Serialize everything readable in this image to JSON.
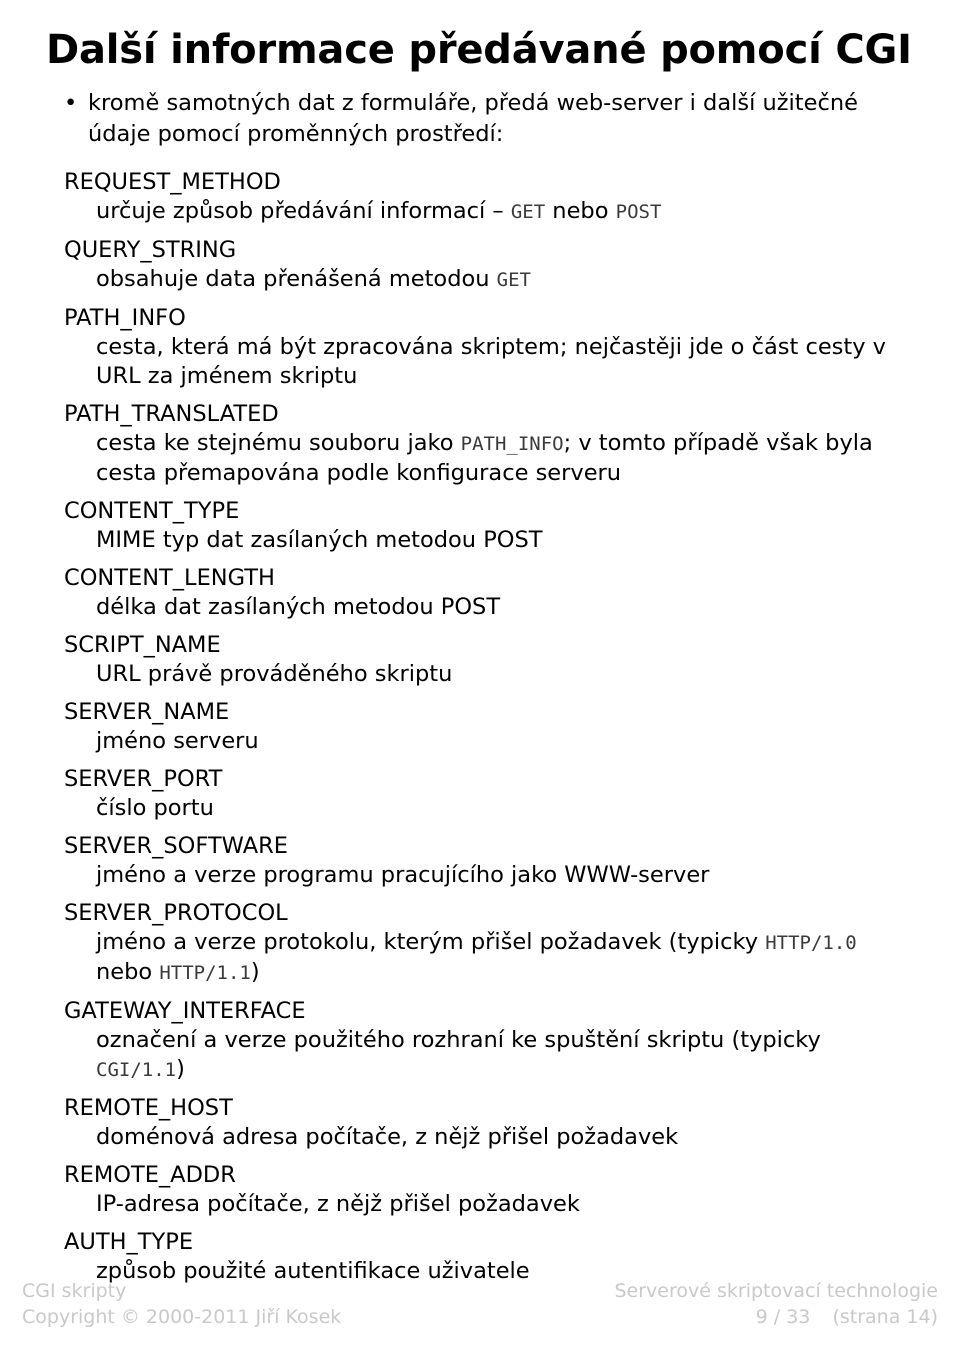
{
  "slide": {
    "title": "Další informace předávané pomocí CGI",
    "bullet": {
      "marker": "•",
      "text": "kromě samotných dat z formuláře, předá web-server i další užitečné údaje pomocí proměnných prostředí:"
    },
    "variables": [
      {
        "term": "REQUEST_METHOD",
        "desc_parts": [
          {
            "type": "text",
            "value": "určuje způsob předávání informací – "
          },
          {
            "type": "code",
            "value": "GET"
          },
          {
            "type": "text",
            "value": " nebo "
          },
          {
            "type": "code",
            "value": "POST"
          }
        ]
      },
      {
        "term": "QUERY_STRING",
        "desc_parts": [
          {
            "type": "text",
            "value": "obsahuje data přenášená metodou "
          },
          {
            "type": "code",
            "value": "GET"
          }
        ]
      },
      {
        "term": "PATH_INFO",
        "desc_parts": [
          {
            "type": "text",
            "value": "cesta, která má být zpracována skriptem; nejčastěji jde o část cesty v URL za jménem skriptu"
          }
        ]
      },
      {
        "term": "PATH_TRANSLATED",
        "desc_parts": [
          {
            "type": "text",
            "value": "cesta ke stejnému souboru jako "
          },
          {
            "type": "code",
            "value": "PATH_INFO"
          },
          {
            "type": "text",
            "value": "; v tomto případě však byla cesta přemapována podle konfigurace serveru"
          }
        ]
      },
      {
        "term": "CONTENT_TYPE",
        "desc_parts": [
          {
            "type": "text",
            "value": "MIME typ dat zasílaných metodou POST"
          }
        ]
      },
      {
        "term": "CONTENT_LENGTH",
        "desc_parts": [
          {
            "type": "text",
            "value": "délka dat zasílaných metodou POST"
          }
        ]
      },
      {
        "term": "SCRIPT_NAME",
        "desc_parts": [
          {
            "type": "text",
            "value": "URL právě prováděného skriptu"
          }
        ]
      },
      {
        "term": "SERVER_NAME",
        "desc_parts": [
          {
            "type": "text",
            "value": "jméno serveru"
          }
        ]
      },
      {
        "term": "SERVER_PORT",
        "desc_parts": [
          {
            "type": "text",
            "value": "číslo portu"
          }
        ]
      },
      {
        "term": "SERVER_SOFTWARE",
        "desc_parts": [
          {
            "type": "text",
            "value": "jméno a verze programu pracujícího jako WWW-server"
          }
        ]
      },
      {
        "term": "SERVER_PROTOCOL",
        "desc_parts": [
          {
            "type": "text",
            "value": "jméno a verze protokolu, kterým přišel požadavek (typicky "
          },
          {
            "type": "code",
            "value": "HTTP/1.0"
          },
          {
            "type": "text",
            "value": " nebo "
          },
          {
            "type": "code",
            "value": "HTTP/1.1"
          },
          {
            "type": "text",
            "value": ")"
          }
        ]
      },
      {
        "term": "GATEWAY_INTERFACE",
        "desc_parts": [
          {
            "type": "text",
            "value": "označení a verze použitého rozhraní ke spuštění skriptu (typicky "
          },
          {
            "type": "code",
            "value": "CGI/1.1"
          },
          {
            "type": "text",
            "value": ")"
          }
        ]
      },
      {
        "term": "REMOTE_HOST",
        "desc_parts": [
          {
            "type": "text",
            "value": "doménová adresa počítače, z nějž přišel požadavek"
          }
        ]
      },
      {
        "term": "REMOTE_ADDR",
        "desc_parts": [
          {
            "type": "text",
            "value": "IP-adresa počítače, z nějž přišel požadavek"
          }
        ]
      },
      {
        "term": "AUTH_TYPE",
        "desc_parts": [
          {
            "type": "text",
            "value": "způsob použité autentifikace uživatele"
          }
        ]
      }
    ]
  },
  "footer": {
    "left_line1": "CGI skripty",
    "left_line2": "Copyright © 2000-2011 Jiří Kosek",
    "right_line1": "Serverové skriptovací technologie",
    "page_current": "9",
    "page_separator": "/",
    "page_total": "33",
    "page_absolute": "(strana 14)"
  },
  "colors": {
    "text": "#000000",
    "code": "#3a3a3a",
    "footer": "#c9c9c9",
    "background": "#ffffff"
  }
}
